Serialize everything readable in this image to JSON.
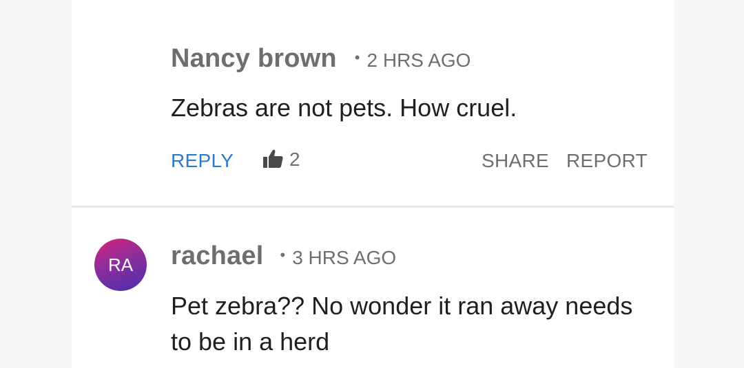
{
  "comments": [
    {
      "author": "Nancy brown",
      "separator": "•",
      "time": "2 HRS AGO",
      "text": "Zebras are not pets. How cruel.",
      "actions": {
        "reply_label": "REPLY",
        "like_icon": "thumbs-up-icon",
        "like_count": "2",
        "share_label": "SHARE",
        "report_label": "REPORT"
      }
    },
    {
      "avatar_initials": "RA",
      "avatar_colors": [
        "#d4227d",
        "#8d2d9b",
        "#4a2fae"
      ],
      "author": "rachael",
      "separator": "•",
      "time": "3 HRS AGO",
      "text": "Pet zebra?? No wonder it ran away needs to be in a herd"
    }
  ],
  "colors": {
    "accent_link": "#2c7bc9",
    "muted_text": "#6e6e6e",
    "body_text": "#1f1f1f",
    "divider": "#e6e6e6"
  }
}
